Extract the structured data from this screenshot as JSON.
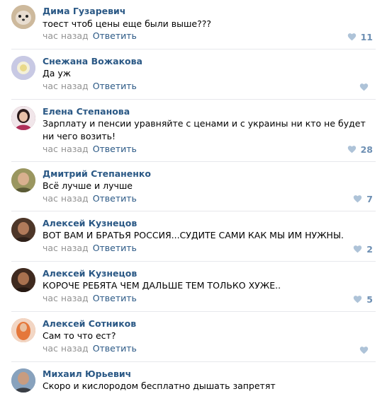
{
  "comments": [
    {
      "author": "Дима Гузаревич",
      "text": "тоест чтоб цены еще были выше???",
      "time": "час назад",
      "reply": "Ответить",
      "likes": "11",
      "avatar_color": "#c9b9a2"
    },
    {
      "author": "Снежана Вожакова",
      "text": "Да уж",
      "time": "час назад",
      "reply": "Ответить",
      "likes": "",
      "avatar_color": "#b6bfd8"
    },
    {
      "author": "Елена Степанова",
      "text": "Зарплату и пенсии уравняйте с ценами и с украины ни кто не будет ни чего возить!",
      "time": "час назад",
      "reply": "Ответить",
      "likes": "28",
      "avatar_color": "#7a3b4e"
    },
    {
      "author": "Дмитрий Степаненко",
      "text": "Всё лучше и лучше",
      "time": "час назад",
      "reply": "Ответить",
      "likes": "7",
      "avatar_color": "#8a8b52"
    },
    {
      "author": "Алексей Кузнецов",
      "text": "ВОТ ВАМ И БРАТЬЯ РОССИЯ...СУДИТЕ САМИ КАК МЫ ИМ НУЖНЫ.",
      "time": "час назад",
      "reply": "Ответить",
      "likes": "2",
      "avatar_color": "#6b4a3a"
    },
    {
      "author": "Алексей Кузнецов",
      "text": "КОРОЧЕ РЕБЯТА ЧЕМ ДАЛЬШЕ ТЕМ ТОЛЬКО ХУЖЕ..",
      "time": "час назад",
      "reply": "Ответить",
      "likes": "5",
      "avatar_color": "#5a3c2c"
    },
    {
      "author": "Алексей Сотников",
      "text": "Сам то что ест?",
      "time": "час назад",
      "reply": "Ответить",
      "likes": "",
      "avatar_color": "#e07b39"
    },
    {
      "author": "Михаил Юрьевич",
      "text": "Скоро и кислородом бесплатно дышать запретят",
      "time": "",
      "reply": "",
      "likes": "",
      "avatar_color": "#5b7a9a"
    }
  ]
}
